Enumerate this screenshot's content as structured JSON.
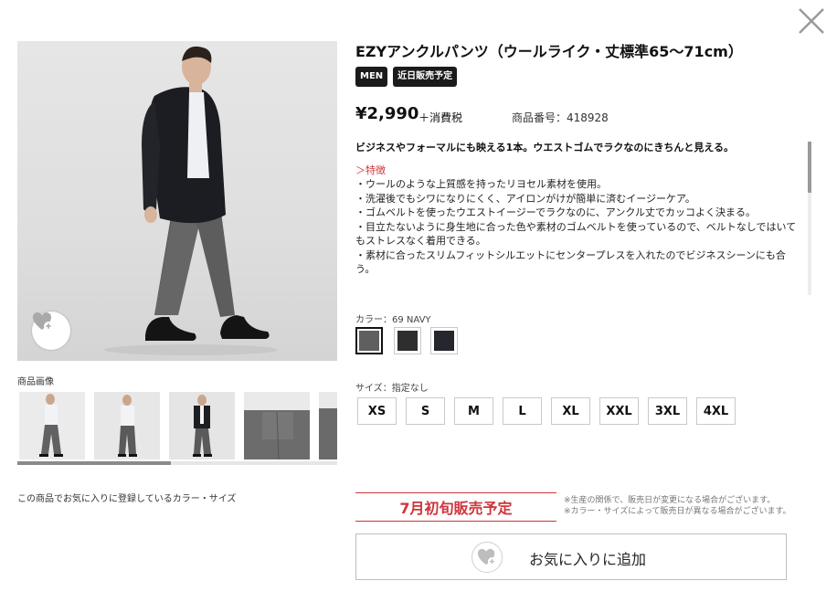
{
  "close_icon": "close-icon",
  "product": {
    "title": "EZYアンクルパンツ（ウールライク・丈標準65～71cm）",
    "badges": [
      "MEN",
      "近日販売予定"
    ],
    "price": "¥2,990",
    "tax": "＋消費税",
    "product_no": "商品番号：418928"
  },
  "gallery": {
    "label": "商品画像",
    "favorite_icon": "heart-plus-icon"
  },
  "description": {
    "headline": "ビジネスやフォーマルにも映える1本。ウエストゴムでラクなのにきちんと見える。",
    "feature_title": "＞特徴",
    "lines": [
      "・ウールのような上質感を持ったリヨセル素材を使用。",
      "・洗濯後でもシワになりにくく、アイロンがけが簡単に済むイージーケア。",
      "・ゴムベルトを使ったウエストイージーでラクなのに、アンクル丈でカッコよく決まる。",
      "・目立たないように身生地に合った色や素材のゴムベルトを使っているので、ベルトなしではいてもストレスなく着用できる。",
      "・素材に合ったスリムフィットシルエットにセンタープレスを入れたのでビジネスシーンにも合う。"
    ]
  },
  "color": {
    "label": "カラー：69 NAVY",
    "swatches": [
      {
        "name": "gray",
        "hex": "#5f5f5f",
        "selected": true
      },
      {
        "name": "black",
        "hex": "#2e2e2e",
        "selected": false
      },
      {
        "name": "navy",
        "hex": "#26262e",
        "selected": false
      }
    ]
  },
  "size": {
    "label": "サイズ：指定なし",
    "options": [
      "XS",
      "S",
      "M",
      "L",
      "XL",
      "XXL",
      "3XL",
      "4XL"
    ]
  },
  "favorites_note": "この商品でお気に入りに登録しているカラー・サイズ",
  "preorder": {
    "label": "7月初旬販売予定",
    "notes": [
      "※生産の関係で、販売日が変更になる場合がございます。",
      "※カラー・サイズによって販売日が異なる場合がございます。"
    ]
  },
  "add_favorite": {
    "label": "お気に入りに追加",
    "icon": "heart-plus-icon"
  },
  "colors": {
    "accent_red": "#d0343b",
    "badge_bg": "#1b1b1b"
  }
}
